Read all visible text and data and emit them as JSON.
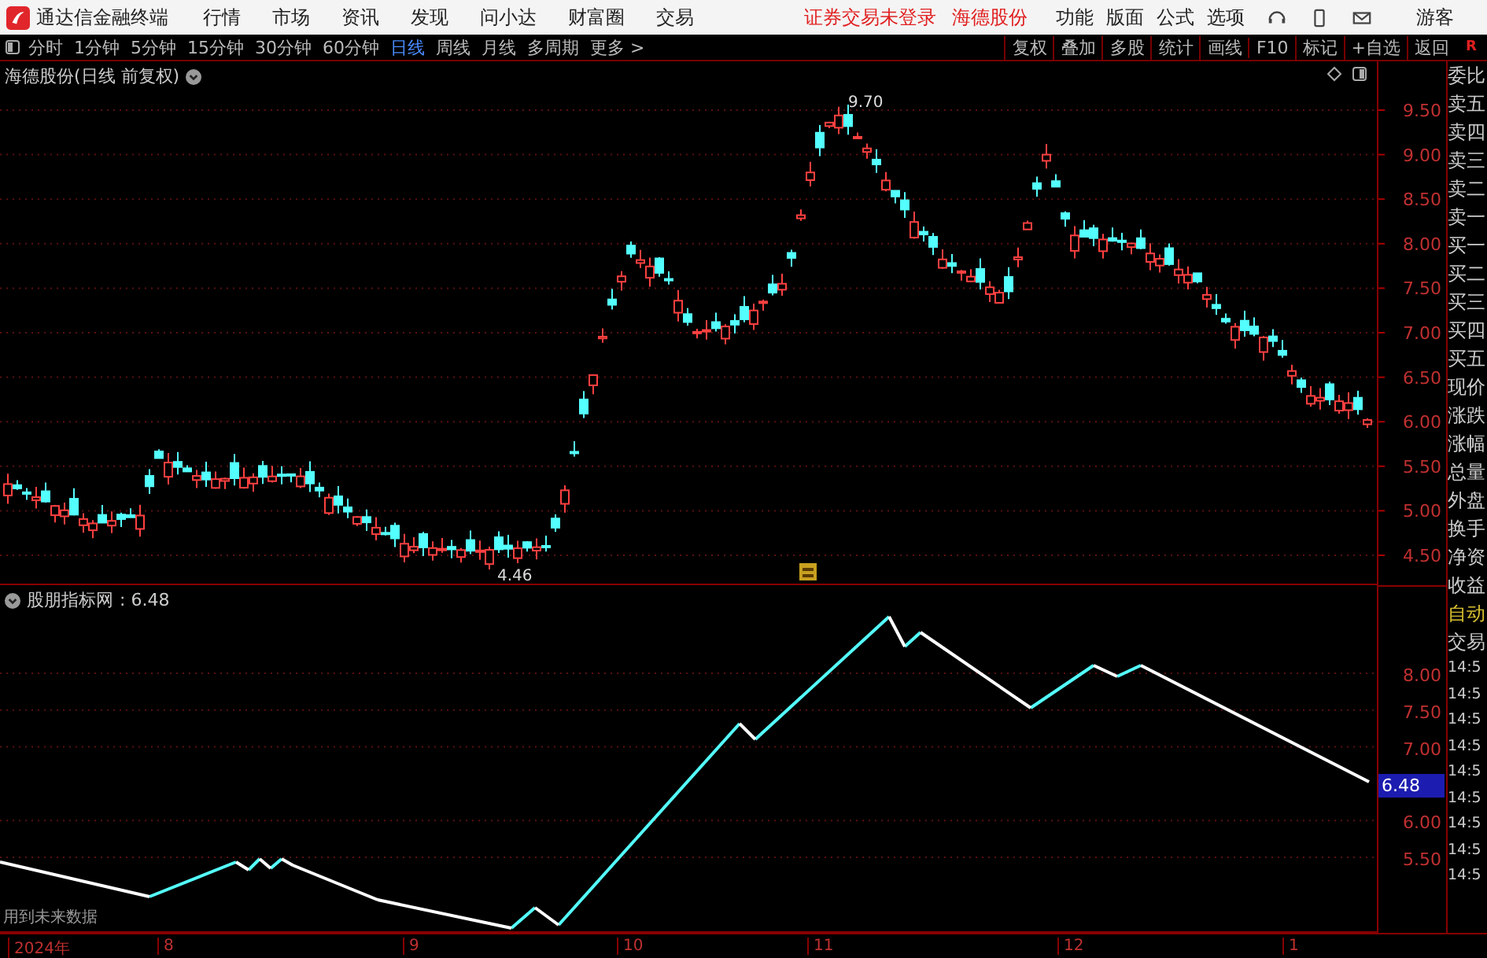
{
  "menu_bar": {
    "app_title": "通达信金融终端",
    "menus": [
      "行情",
      "市场",
      "资讯",
      "发现",
      "问小达",
      "财富圈",
      "交易"
    ],
    "notices": [
      "证券交易未登录",
      "海德股份"
    ],
    "tools": [
      "功能",
      "版面",
      "公式",
      "选项"
    ],
    "user": "游客"
  },
  "toolbar": {
    "periods": [
      {
        "label": "分时",
        "selected": false
      },
      {
        "label": "1分钟",
        "selected": false
      },
      {
        "label": "5分钟",
        "selected": false
      },
      {
        "label": "15分钟",
        "selected": false
      },
      {
        "label": "30分钟",
        "selected": false
      },
      {
        "label": "60分钟",
        "selected": false
      },
      {
        "label": "日线",
        "selected": true
      },
      {
        "label": "周线",
        "selected": false
      },
      {
        "label": "月线",
        "selected": false
      },
      {
        "label": "多周期",
        "selected": false
      },
      {
        "label": "更多 >",
        "selected": false
      }
    ],
    "actions": [
      "复权",
      "叠加",
      "多股",
      "统计",
      "画线",
      "F10",
      "标记",
      "+自选",
      "返回"
    ],
    "corner_mark": "R"
  },
  "main_chart": {
    "title": "海德股份(日线 前复权)",
    "price_ticks": [
      "9.50",
      "9.00",
      "8.50",
      "8.00",
      "7.50",
      "7.00",
      "6.50",
      "6.00",
      "5.50",
      "5.00",
      "4.50"
    ],
    "high_label": "9.70",
    "low_label": "4.46"
  },
  "indicator_chart": {
    "name": "股朋指标网",
    "value": ": 6.48",
    "ticks": [
      "8.00",
      "7.50",
      "7.00",
      "6.00",
      "5.50"
    ],
    "current_badge": "6.48",
    "warning": "用到未来数据"
  },
  "x_axis": [
    "2024年",
    "8",
    "9",
    "10",
    "11",
    "12",
    "1"
  ],
  "quote_panel": {
    "labels": [
      "委比",
      "卖五",
      "卖四",
      "卖三",
      "卖二",
      "卖一",
      "买一",
      "买二",
      "买三",
      "买四",
      "买五",
      "现价",
      "涨跌",
      "涨幅",
      "总量",
      "外盘",
      "换手",
      "净资",
      "收益"
    ],
    "auto_label": "自动",
    "trade_label": "交易",
    "times": [
      "14:5",
      "14:5",
      "14:5",
      "14:5",
      "14:5",
      "14:5",
      "14:5",
      "14:5",
      "14:5"
    ]
  }
}
